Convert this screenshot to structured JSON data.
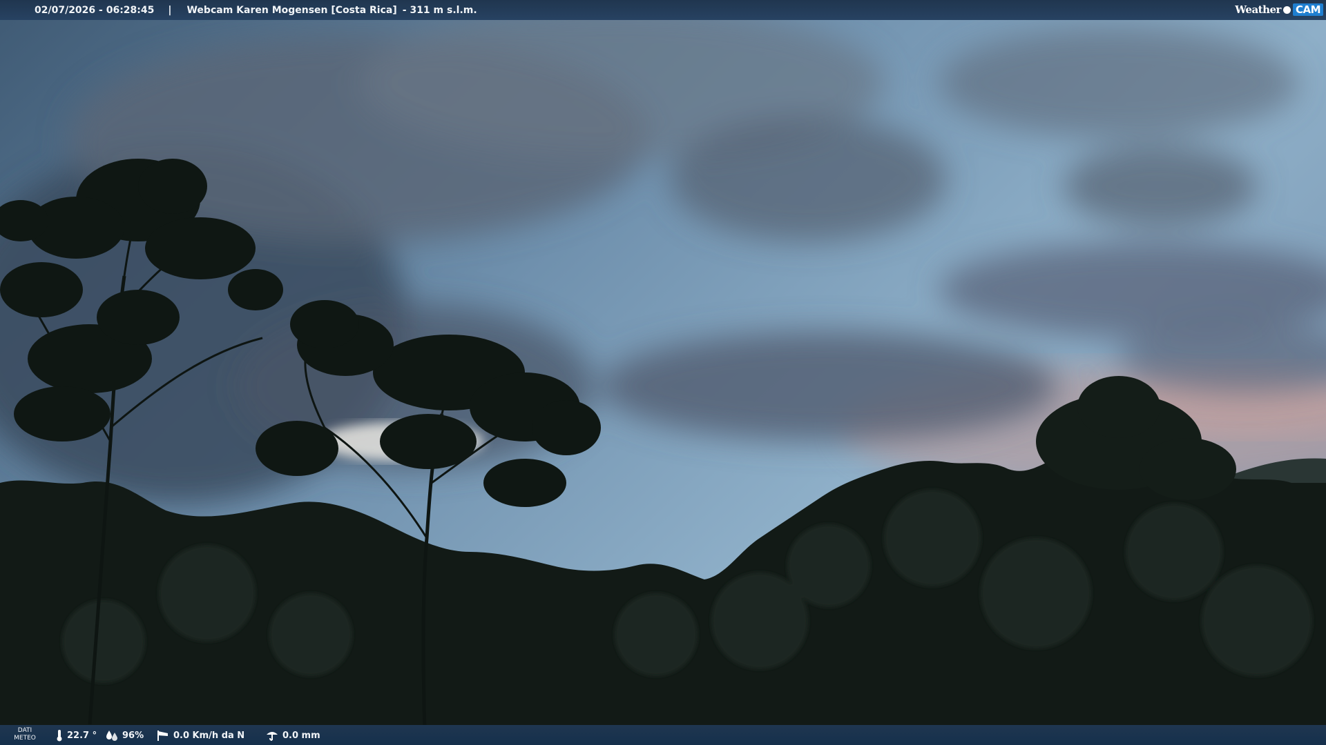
{
  "header": {
    "datetime": "02/07/2026 - 06:28:45",
    "separator": "|",
    "location": "Webcam Karen Mogensen [Costa Rica]",
    "altitude": "- 311 m s.l.m.",
    "brand_text": "Weather",
    "brand_cam": "CAM"
  },
  "weather": {
    "label_line1": "DATI",
    "label_line2": "METEO",
    "temperature": "22.7 °",
    "humidity": "96%",
    "wind": "0.0 Km/h da N",
    "rain": "0.0 mm"
  },
  "icons": {
    "temperature": "thermometer-icon",
    "humidity": "humidity-drops-icon",
    "wind": "wind-sock-icon",
    "rain": "rain-gauge-icon",
    "brand_logo": "weathercam-logo-icon"
  },
  "colors": {
    "bar": "#22395a",
    "brand_accent": "#1f7fd0"
  }
}
